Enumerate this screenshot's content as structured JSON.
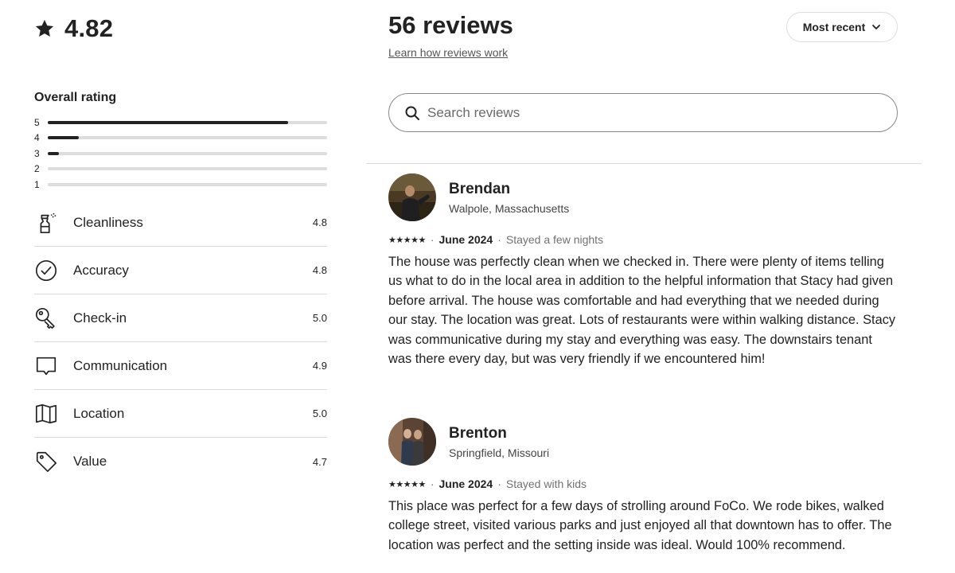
{
  "summary": {
    "overall_score": "4.82",
    "overall_label": "Overall rating",
    "distribution": [
      {
        "label": "5",
        "fraction": 0.86
      },
      {
        "label": "4",
        "fraction": 0.11
      },
      {
        "label": "3",
        "fraction": 0.04
      },
      {
        "label": "2",
        "fraction": 0.0
      },
      {
        "label": "1",
        "fraction": 0.0
      }
    ],
    "categories": [
      {
        "label": "Cleanliness",
        "value": "4.8",
        "icon": "spray-bottle-icon"
      },
      {
        "label": "Accuracy",
        "value": "4.8",
        "icon": "check-circle-icon"
      },
      {
        "label": "Check-in",
        "value": "5.0",
        "icon": "key-icon"
      },
      {
        "label": "Communication",
        "value": "4.9",
        "icon": "chat-bubble-icon"
      },
      {
        "label": "Location",
        "value": "5.0",
        "icon": "map-icon"
      },
      {
        "label": "Value",
        "value": "4.7",
        "icon": "tag-icon"
      }
    ]
  },
  "header": {
    "title": "56 reviews",
    "learn_link": "Learn how reviews work",
    "sort_label": "Most recent"
  },
  "search": {
    "placeholder": "Search reviews",
    "value": ""
  },
  "reviews": [
    {
      "name": "Brendan",
      "location": "Walpole, Massachusetts",
      "stars": "★★★★★",
      "date": "June 2024",
      "stay": "Stayed a few nights",
      "text": "The house was perfectly clean when we checked in. There were plenty of items telling us what to do in the local area in addition to the helpful information that Stacy had given before arrival. The house was comfortable and had everything that we needed during our stay. The location was great. Lots of restaurants were within walking distance. Stacy was communicative during my stay and everything was easy. The downstairs tenant was there every day, but was very friendly if we encountered him!"
    },
    {
      "name": "Brenton",
      "location": "Springfield, Missouri",
      "stars": "★★★★★",
      "date": "June 2024",
      "stay": "Stayed with kids",
      "text": "This place was perfect for a few days of strolling around FoCo. We rode bikes, walked college street, visited various parks and just enjoyed all that downtown has to offer. The location was perfect and the setting inside was ideal. Would 100% recommend."
    }
  ],
  "colors": {
    "text": "#222222",
    "muted": "#717171",
    "divider": "#dddddd",
    "bar_fill": "#222222",
    "bar_track": "#dddddd"
  }
}
